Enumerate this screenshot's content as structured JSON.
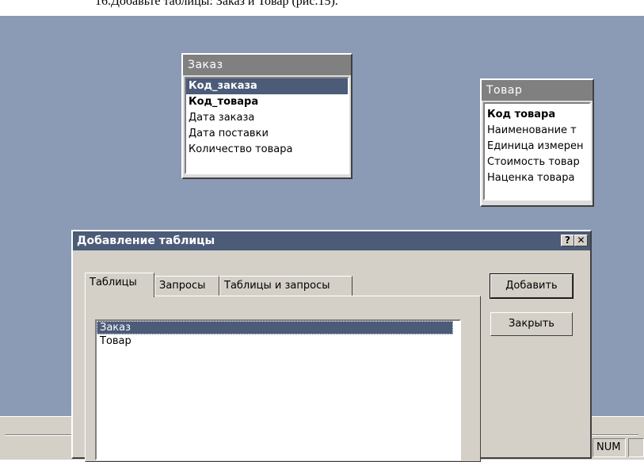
{
  "document": {
    "caption": "16.Добавьте таблицы: Заказ и Товар (рис.15)."
  },
  "relationships_window": {
    "tables": [
      {
        "title": "Заказ",
        "fields": [
          {
            "label": "Код_заказа",
            "key": true,
            "selected": true
          },
          {
            "label": "Код_товара",
            "key": true,
            "selected": false
          },
          {
            "label": "Дата заказа",
            "key": false,
            "selected": false
          },
          {
            "label": "Дата поставки",
            "key": false,
            "selected": false
          },
          {
            "label": "Количество товара",
            "key": false,
            "selected": false
          }
        ]
      },
      {
        "title": "Товар",
        "fields": [
          {
            "label": "Код товара",
            "key": true,
            "selected": false
          },
          {
            "label": "Наименование т",
            "key": false,
            "selected": false
          },
          {
            "label": "Единица измерен",
            "key": false,
            "selected": false
          },
          {
            "label": "Стоимость товар",
            "key": false,
            "selected": false
          },
          {
            "label": "Наценка товара",
            "key": false,
            "selected": false
          }
        ]
      }
    ]
  },
  "dialog": {
    "title": "Добавление таблицы",
    "help_label": "?",
    "close_label": "✕",
    "tabs": [
      {
        "label": "Таблицы",
        "active": true
      },
      {
        "label": "Запросы",
        "active": false
      },
      {
        "label": "Таблицы и запросы",
        "active": false
      }
    ],
    "list_items": [
      {
        "label": "Заказ",
        "selected": true
      },
      {
        "label": "Товар",
        "selected": false
      }
    ],
    "add_button": "Добавить",
    "close_button": "Закрыть"
  },
  "status_bar": {
    "num_indicator": "NUM"
  },
  "colors": {
    "workspace": "#8b9ab5",
    "title_active": "#4b5b78",
    "title_inactive": "#808080",
    "face": "#d4d0c8"
  }
}
